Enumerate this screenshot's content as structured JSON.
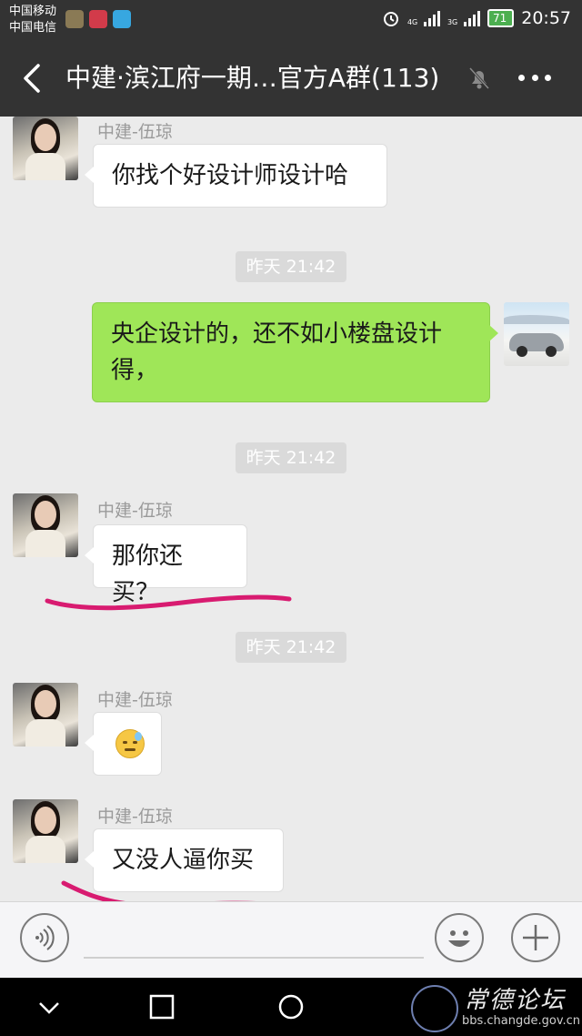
{
  "status_bar": {
    "carrier_1": "中国移动",
    "carrier_2": "中国电信",
    "network_1": "4G",
    "network_2": "3G",
    "battery": "71",
    "time": "20:57"
  },
  "header": {
    "title": "中建·滨江府一期…官方A群(113)",
    "icons": [
      "back-icon",
      "mute-icon",
      "more-icon"
    ]
  },
  "messages": [
    {
      "side": "left",
      "sender": "中建-伍琼",
      "text": "你找个好设计师设计哈"
    },
    {
      "type": "time",
      "text": "昨天 21:42"
    },
    {
      "side": "right",
      "text_line1": "央企设计的，还不如小楼盘设计",
      "text_line2": "得，"
    },
    {
      "type": "time",
      "text": "昨天 21:42"
    },
    {
      "side": "left",
      "sender": "中建-伍琼",
      "text": "那你还买？"
    },
    {
      "type": "time",
      "text": "昨天 21:42"
    },
    {
      "side": "left",
      "sender": "中建-伍琼",
      "emoji": "sweat-face-emoji"
    },
    {
      "side": "left",
      "sender": "中建-伍琼",
      "text": "又没人逼你买"
    }
  ],
  "input_bar": {
    "placeholder": "",
    "icons": [
      "voice-icon",
      "emoji-icon",
      "plus-icon"
    ]
  },
  "watermark": {
    "title": "常德论坛",
    "url": "bbs.changde.gov.cn"
  },
  "colors": {
    "bar_bg": "#333333",
    "chat_bg": "#ebebeb",
    "my_bubble": "#9fe658",
    "underline": "#d81b70"
  }
}
